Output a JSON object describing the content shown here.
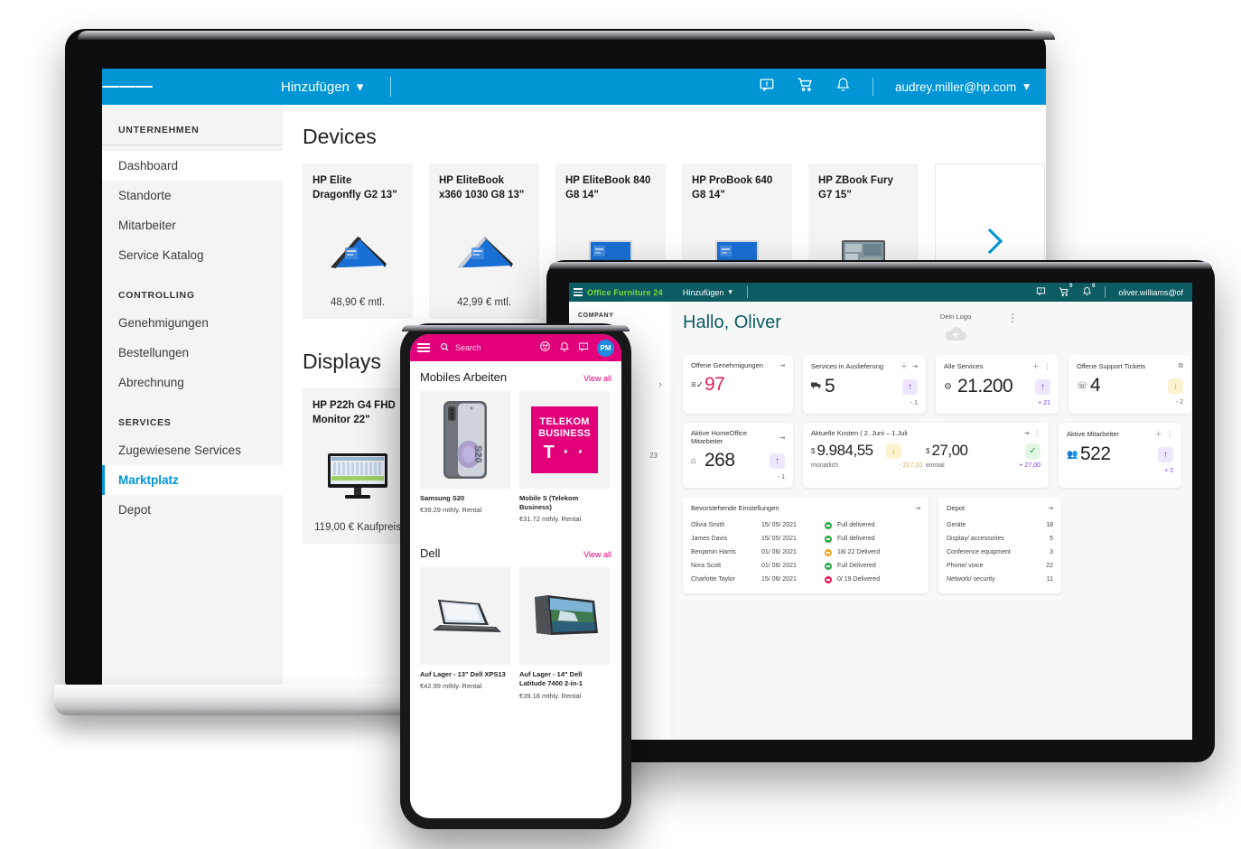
{
  "laptop": {
    "topbar": {
      "menu_icon": "hamburger-icon",
      "add_label": "Hinzufügen",
      "chevron": "▾",
      "feedback_icon": "feedback-icon",
      "cart_icon": "cart-icon",
      "bell_icon": "bell-icon",
      "user_email": "audrey.miller@hp.com"
    },
    "sidebar": {
      "groups": [
        {
          "label": "UNTERNEHMEN",
          "items": [
            {
              "label": "Dashboard",
              "active": false,
              "white": true
            },
            {
              "label": "Standorte",
              "active": false
            },
            {
              "label": "Mitarbeiter",
              "active": false
            },
            {
              "label": "Service Katalog",
              "active": false
            }
          ]
        },
        {
          "label": "CONTROLLING",
          "items": [
            {
              "label": "Genehmigungen"
            },
            {
              "label": "Bestellungen"
            },
            {
              "label": "Abrechnung"
            }
          ]
        },
        {
          "label": "SERVICES",
          "items": [
            {
              "label": "Zugewiesene Services",
              "active": false
            },
            {
              "label": "Marktplatz",
              "active": true
            },
            {
              "label": "Depot",
              "active": false
            }
          ]
        }
      ]
    },
    "sections": [
      {
        "title": "Devices",
        "cards": [
          {
            "title": "HP Elite Dragonfly G2 13\"",
            "price": "48,90 € mtl.",
            "img": "laptop-tent-dark"
          },
          {
            "title": "HP EliteBook x360 1030 G8 13\"",
            "price": "42,99 € mtl.",
            "img": "laptop-tent-silver"
          },
          {
            "title": "HP EliteBook 840 G8 14\"",
            "price": "",
            "img": "laptop-open-silver"
          },
          {
            "title": "HP ProBook 640 G8 14\"",
            "price": "",
            "img": "laptop-open-silver"
          },
          {
            "title": "HP ZBook Fury G7 15\"",
            "price": "",
            "img": "laptop-open-gray"
          }
        ],
        "next_label": "›"
      },
      {
        "title": "Displays",
        "cards": [
          {
            "title": "HP P22h G4 FHD Monitor 22\"",
            "price": "119,00 € Kaufpreis",
            "img": "monitor"
          }
        ]
      }
    ]
  },
  "tablet": {
    "topbar": {
      "menu_icon": "hamburger-icon",
      "brand": "Office Furniture 24",
      "add_label": "Hinzufügen",
      "chevron": "▾",
      "feedback_icon": "feedback-icon",
      "cart_icon": "cart-icon",
      "cart_badge": "0",
      "bell_icon": "bell-icon",
      "bell_badge": "0",
      "user_email": "oliver.williams@of"
    },
    "sidebar": {
      "group_label": "COMPANY",
      "collapse_icon": "›",
      "count": "23"
    },
    "header": {
      "greeting": "Hallo, Oliver",
      "logo_label": "Dein Logo",
      "upload_icon": "cloud-upload-icon",
      "kebab_icon": "kebab-menu-icon"
    },
    "kpis": [
      {
        "title": "Offene Genehmigungen",
        "icon": "approvals-icon",
        "value": "97",
        "value_color": "red",
        "actions": [
          "expand-icon"
        ],
        "delta": "",
        "delta_color": "",
        "badge": "",
        "badge_bg": "",
        "foot_left": ""
      },
      {
        "title": "Services in Auslieferung",
        "icon": "truck-icon",
        "value": "5",
        "value_color": "",
        "actions": [
          "plus-icon",
          "expand-icon"
        ],
        "delta": "- 1",
        "delta_color": "gray",
        "badge": "↑",
        "badge_bg": "purple",
        "foot_left": ""
      },
      {
        "title": "Alle Services",
        "icon": "gear-icon",
        "value": "21.200",
        "value_color": "",
        "actions": [
          "plus-icon",
          "kebab-icon"
        ],
        "delta": "+ 21",
        "delta_color": "purple",
        "badge": "↑",
        "badge_bg": "purple",
        "foot_left": ""
      },
      {
        "title": "Offene Support Tickets",
        "icon": "headset-icon",
        "value": "4",
        "value_color": "",
        "actions": [
          "external-link-icon"
        ],
        "delta": "- 2",
        "delta_color": "gray",
        "badge": "↓",
        "badge_bg": "yellow",
        "foot_left": ""
      },
      {
        "title": "Aktive HomeOffice Mitarbeiter",
        "icon": "home-icon",
        "value": "268",
        "value_color": "",
        "actions": [
          "expand-icon"
        ],
        "delta": "- 1",
        "delta_color": "gray",
        "badge": "↑",
        "badge_bg": "purple",
        "foot_left": ""
      },
      {
        "title": "Aktuelle Kosten ( 2. Juni – 1.Juli",
        "icon": "currency-icon",
        "value": "9.984,55",
        "value_color": "",
        "actions": [],
        "delta": "- 217,10",
        "delta_color": "orange",
        "badge": "↓",
        "badge_bg": "yellow",
        "foot_left": "monatlich",
        "currency": "$"
      },
      {
        "title": "",
        "icon": "currency-icon",
        "value": "27,00",
        "value_color": "",
        "actions": [
          "expand-icon",
          "kebab-icon"
        ],
        "delta": "+ 27,00",
        "delta_color": "purple",
        "badge": "✓",
        "badge_bg": "green",
        "foot_left": "einmal",
        "currency": "$"
      },
      {
        "title": "Aktive Mitarbeiter",
        "icon": "people-icon",
        "value": "522",
        "value_color": "",
        "actions": [
          "plus-icon",
          "kebab-icon"
        ],
        "delta": "+ 2",
        "delta_color": "purple",
        "badge": "↑",
        "badge_bg": "purple",
        "foot_left": ""
      }
    ],
    "upcoming": {
      "title": "Bevorstehende Einstellungen",
      "action": "expand-icon",
      "rows": [
        {
          "name": "Olivia Smith",
          "date": "15/ 05/ 2021",
          "status": "Full delivered",
          "dot": "g"
        },
        {
          "name": "James Davis",
          "date": "15/ 05/ 2021",
          "status": "Full delivered",
          "dot": "g"
        },
        {
          "name": "Benjamin Harris",
          "date": "01/ 06/ 2021",
          "status": "18/ 22 Deliverd",
          "dot": "o"
        },
        {
          "name": "Nora Scott",
          "date": "01/ 06/ 2021",
          "status": "Full Delivered",
          "dot": "g"
        },
        {
          "name": "Charlotte Taylor",
          "date": "15/ 06/ 2021",
          "status": "0/ 19 Delivered",
          "dot": "p"
        }
      ]
    },
    "depot": {
      "title": "Depot",
      "action": "expand-icon",
      "rows": [
        {
          "name": "Geräte",
          "value": "18"
        },
        {
          "name": "Display/ accessories",
          "value": "5"
        },
        {
          "name": "Conference equipment",
          "value": "3"
        },
        {
          "name": "Phone/ voice",
          "value": "22"
        },
        {
          "name": "Network/ security",
          "value": "11"
        }
      ]
    }
  },
  "phone": {
    "topbar": {
      "menu_icon": "hamburger-icon",
      "search_icon": "search-icon",
      "search_placeholder": "Search",
      "help_icon": "help-icon",
      "bell_icon": "bell-icon",
      "feedback_icon": "feedback-icon",
      "avatar_initials": "PM"
    },
    "sections": [
      {
        "title": "Mobiles Arbeiten",
        "view_all": "View all",
        "cards": [
          {
            "name": "Samsung S20",
            "price": "€39.29 mthly. Rental",
            "img": "phone-s20"
          },
          {
            "name": "Mobile S (Telekom Business)",
            "price": "€31.72 mthly. Rental",
            "img": "telekom-tile",
            "tile_line1": "TELEKOM",
            "tile_line2": "BUSINESS",
            "tile_logo": "T · ·"
          }
        ]
      },
      {
        "title": "Dell",
        "view_all": "View all",
        "cards": [
          {
            "name": "Auf Lager - 13\" Dell XPS13",
            "price": "€42.99 mthly. Rental",
            "img": "dell-xps"
          },
          {
            "name": "Auf Lager - 14\" Dell Latitude 7400 2-in-1",
            "price": "€39.18 mthly. Rental",
            "img": "dell-latitude"
          }
        ]
      }
    ]
  },
  "colors": {
    "hp_blue": "#0096d6",
    "telekom_magenta": "#e2007a",
    "tablet_teal": "#0d5b63",
    "tablet_green": "#7ddc3c",
    "accent_purple": "#7c3aed",
    "accent_red": "#e2225e",
    "accent_yellow": "#e0a800",
    "accent_green": "#2faa4a"
  }
}
